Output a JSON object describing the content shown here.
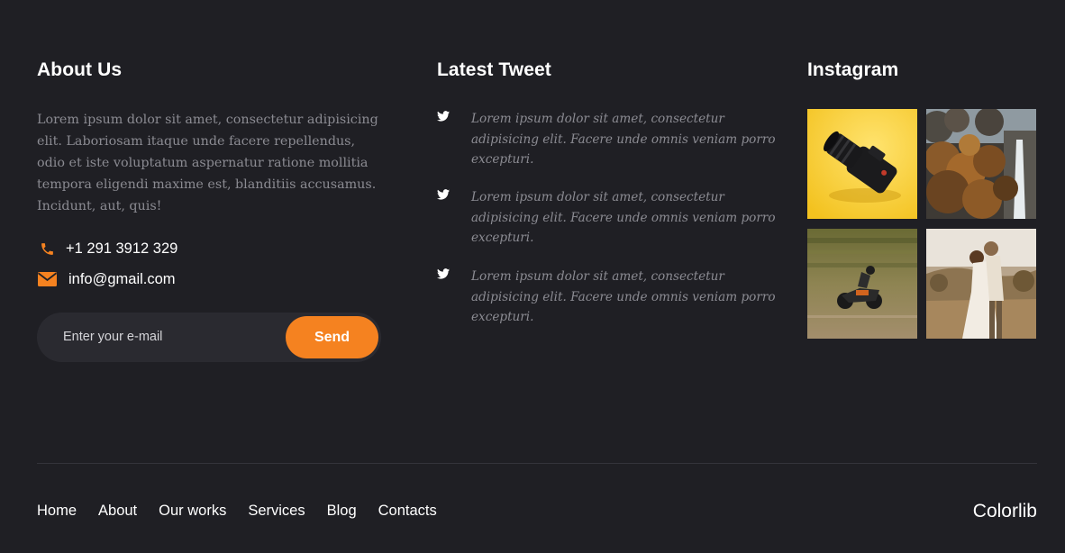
{
  "about": {
    "heading": "About Us",
    "text": "Lorem ipsum dolor sit amet, consectetur adipisicing elit. Laboriosam itaque unde facere repellendus, odio et iste voluptatum aspernatur ratione mollitia tempora eligendi maxime est, blanditiis accusamus. Incidunt, aut, quis!",
    "phone": "+1 291 3912 329",
    "email": "info@gmail.com",
    "phone_icon": "phone-icon",
    "email_icon": "envelope-icon",
    "newsletter": {
      "placeholder": "Enter your e-mail",
      "button_label": "Send"
    }
  },
  "tweets": {
    "heading": "Latest Tweet",
    "icon": "twitter-icon",
    "items": [
      {
        "text": "Lorem ipsum dolor sit amet, consectetur adipisicing elit. Facere unde omnis veniam porro excepturi."
      },
      {
        "text": "Lorem ipsum dolor sit amet, consectetur adipisicing elit. Facere unde omnis veniam porro excepturi."
      },
      {
        "text": "Lorem ipsum dolor sit amet, consectetur adipisicing elit. Facere unde omnis veniam porro excepturi."
      }
    ]
  },
  "instagram": {
    "heading": "Instagram",
    "images": [
      {
        "name": "camera-photo"
      },
      {
        "name": "waterfall-photo"
      },
      {
        "name": "motorcycle-photo"
      },
      {
        "name": "couple-photo"
      }
    ]
  },
  "footer": {
    "nav": [
      "Home",
      "About",
      "Our works",
      "Services",
      "Blog",
      "Contacts"
    ],
    "brand": "Colorlib"
  },
  "colors": {
    "background": "#1f1f24",
    "accent": "#f58220",
    "body_text": "#8b8b92",
    "input_bg": "#2a2a30"
  }
}
